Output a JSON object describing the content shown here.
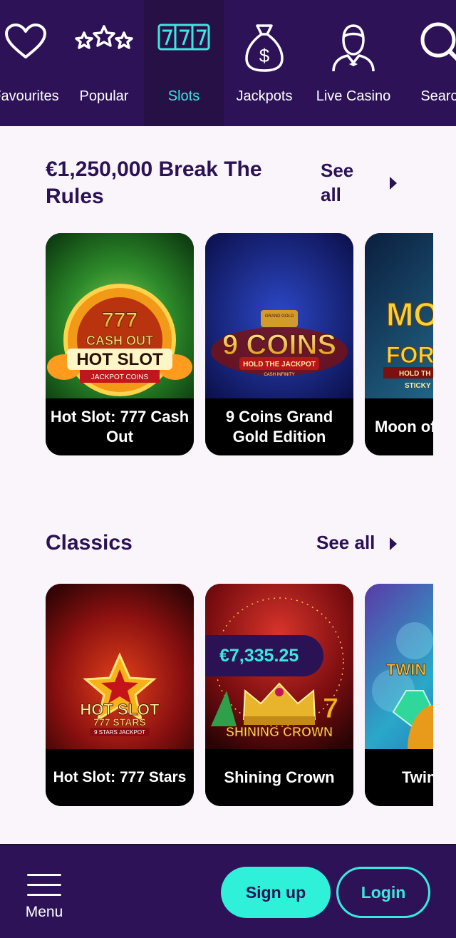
{
  "nav": {
    "items": [
      {
        "label": "Favourites",
        "icon": "heart-icon"
      },
      {
        "label": "Popular",
        "icon": "stars-icon"
      },
      {
        "label": "Slots",
        "icon": "slot-777-icon",
        "active": true
      },
      {
        "label": "Jackpots",
        "icon": "money-bag-icon"
      },
      {
        "label": "Live Casino",
        "icon": "dealer-icon"
      },
      {
        "label": "Search",
        "icon": "search-icon"
      }
    ]
  },
  "sections": [
    {
      "title": "€1,250,000 Break The Rules",
      "see_all": "See all",
      "games": [
        {
          "name": "Hot Slot: 777 Cash Out",
          "art_text": [
            "777",
            "CASH OUT",
            "HOT SLOT",
            "JACKPOT COINS"
          ]
        },
        {
          "name": "9 Coins Grand Gold Edition",
          "art_text": [
            "GRAND GOLD",
            "9 COINS",
            "HOLD THE JACKPOT",
            "CASH INFINITY"
          ]
        },
        {
          "name": "Moon of Fortune",
          "art_text": [
            "MO",
            "FOR",
            "HOLD TH",
            "STICKY"
          ]
        }
      ]
    },
    {
      "title": "Classics",
      "see_all": "See all",
      "games": [
        {
          "name": "Hot Slot: 777 Stars",
          "art_text": [
            "HOT SLOT",
            "777 STARS",
            "9 STARS JACKPOT"
          ]
        },
        {
          "name": "Shining Crown",
          "jackpot": "€7,335.25",
          "art_text": [
            "SHINING CROWN"
          ]
        },
        {
          "name": "Twin",
          "art_text": [
            "TWIN"
          ]
        }
      ]
    }
  ],
  "bottom": {
    "menu_label": "Menu",
    "signup_label": "Sign up",
    "login_label": "Login"
  },
  "colors": {
    "nav_bg": "#2e1257",
    "accent": "#3be8e0",
    "page_bg": "#faf4fb",
    "heading": "#2a1255"
  }
}
